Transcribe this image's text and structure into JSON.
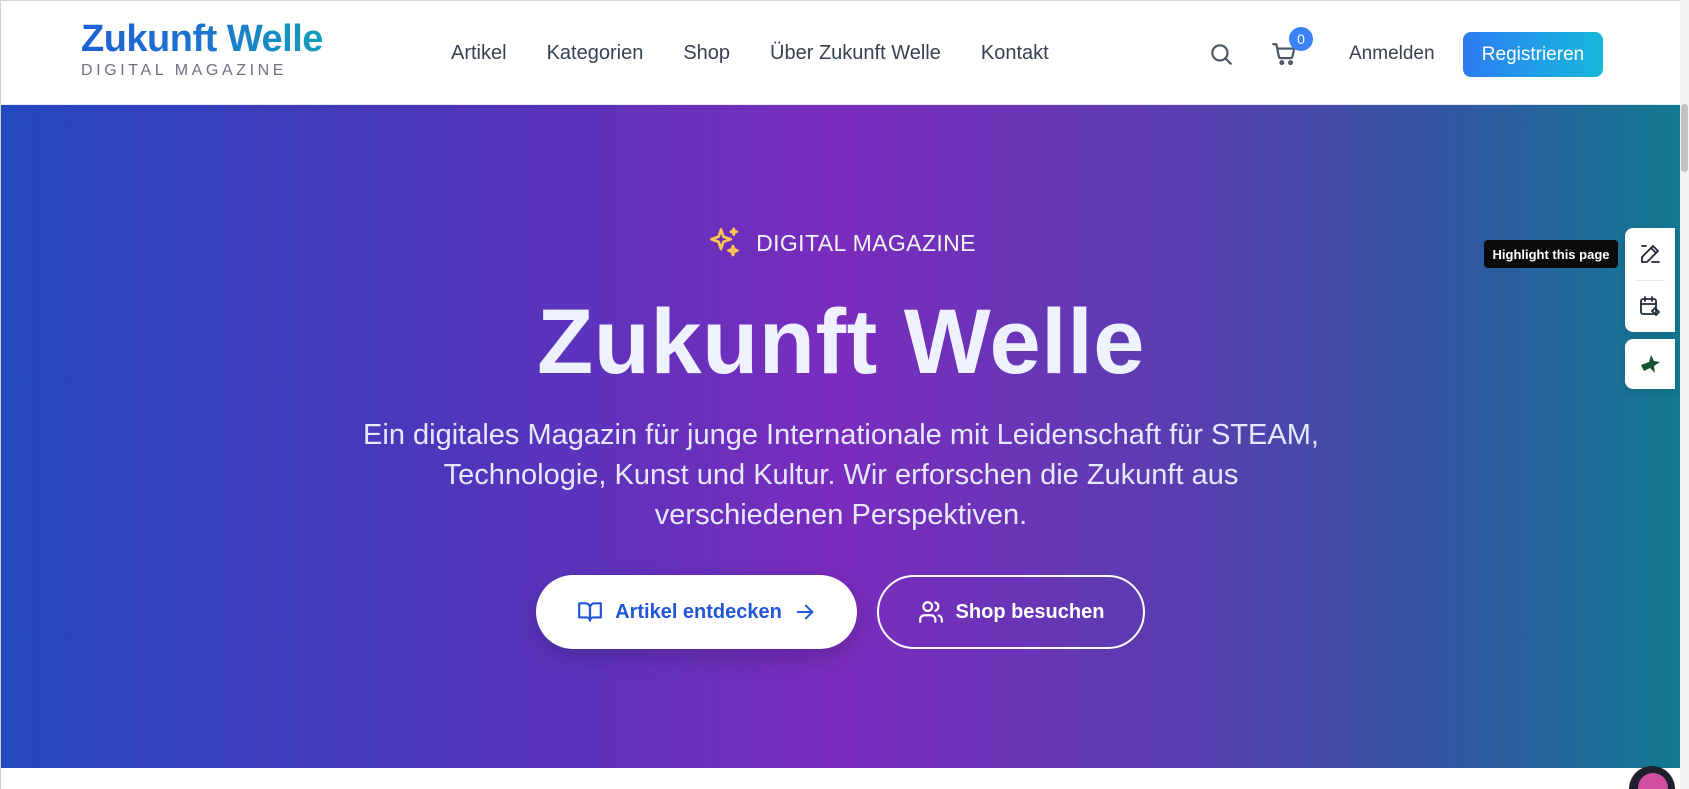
{
  "brand": {
    "title": "Zukunft Welle",
    "subtitle": "DIGITAL MAGAZINE"
  },
  "nav": {
    "items": [
      {
        "label": "Artikel"
      },
      {
        "label": "Kategorien"
      },
      {
        "label": "Shop"
      },
      {
        "label": "Über Zukunft Welle"
      },
      {
        "label": "Kontakt"
      }
    ]
  },
  "header_actions": {
    "search_icon": "search-icon",
    "cart_icon": "cart-icon",
    "cart_count": "0",
    "login_label": "Anmelden",
    "register_label": "Registrieren"
  },
  "hero": {
    "eyebrow": "DIGITAL MAGAZINE",
    "title": "Zukunft Welle",
    "description": "Ein digitales Magazin für junge Internationale mit Leidenschaft für STEAM, Technologie, Kunst und Kultur. Wir erforschen die Zukunft aus verschiedenen Perspektiven.",
    "primary_cta": "Artikel entdecken",
    "secondary_cta": "Shop besuchen"
  },
  "side_widget": {
    "tooltip": "Highlight this page"
  },
  "colors": {
    "accent": "#2d7bf0",
    "brand_blue": "#1f5fd6",
    "hero_purple": "#7a2cbd",
    "eyebrow_icon": "#f9c74f"
  }
}
